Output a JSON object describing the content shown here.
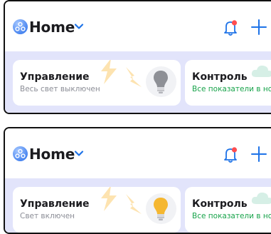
{
  "screens": [
    {
      "header": {
        "home_label": "Home"
      },
      "control_card": {
        "title": "Управление",
        "subtitle": "Весь свет выключен",
        "bulb_state": "off"
      },
      "monitor_card": {
        "title": "Контроль",
        "subtitle": "Все показатели в но"
      }
    },
    {
      "header": {
        "home_label": "Home"
      },
      "control_card": {
        "title": "Управление",
        "subtitle": "Свет включен",
        "bulb_state": "on"
      },
      "monitor_card": {
        "title": "Контроль",
        "subtitle": "Все показатели в но"
      }
    }
  ],
  "icons": {
    "logo": "home-logo-icon",
    "chevron": "chevron-down-icon",
    "bell": "bell-notification-icon",
    "plus": "plus-icon",
    "bulb": "light-bulb-icon",
    "cloud": "cloud-icon"
  },
  "colors": {
    "accent": "#1e73e8",
    "bell_dot": "#ff4d4f",
    "content_bg": "#e2e4fb",
    "bulb_on": "#f5b731",
    "bulb_off": "#8e9096",
    "monitor_text": "#17a34a",
    "bolt": "#fde3b0"
  }
}
